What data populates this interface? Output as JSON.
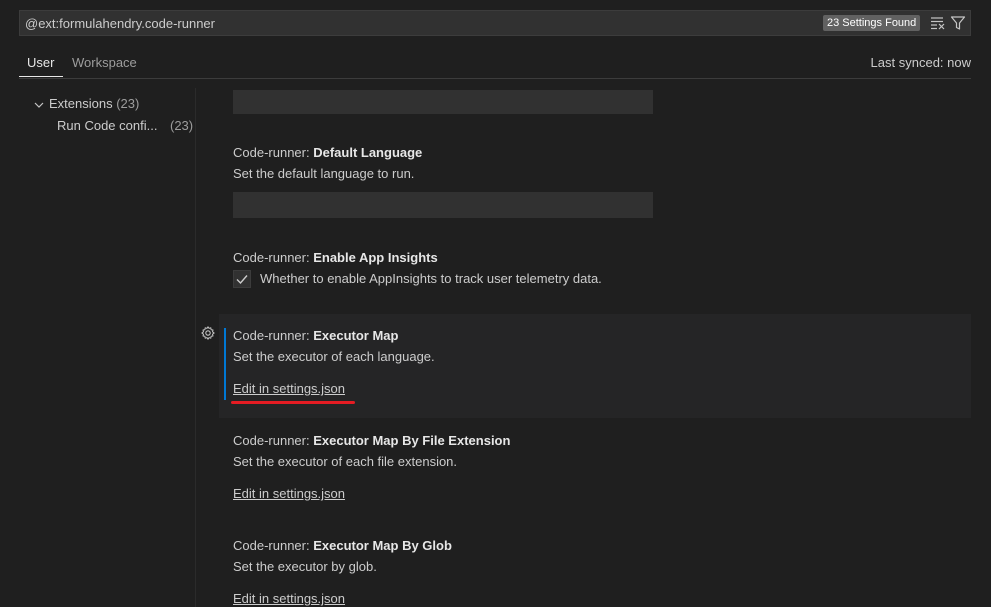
{
  "search": {
    "query": "@ext:formulahendry.code-runner",
    "results_badge": "23 Settings Found",
    "clear_icon": "clear-filter-icon",
    "filter_icon": "filter-icon"
  },
  "tabs": {
    "user_label": "User",
    "workspace_label": "Workspace",
    "active": "User"
  },
  "sync_status": "Last synced: now",
  "toc": {
    "root_label": "Extensions",
    "root_count": "(23)",
    "child_label": "Run Code confi...",
    "child_count": "(23)"
  },
  "settings": [
    {
      "category": "Code-runner: ",
      "key": "Default Language",
      "description": "Set the default language to run.",
      "input_value": ""
    },
    {
      "category": "Code-runner: ",
      "key": "Enable App Insights",
      "checkbox_label": "Whether to enable AppInsights to track user telemetry data.",
      "checked": true
    },
    {
      "category": "Code-runner: ",
      "key": "Executor Map",
      "description": "Set the executor of each language.",
      "link": "Edit in settings.json"
    },
    {
      "category": "Code-runner: ",
      "key": "Executor Map By File Extension",
      "description": "Set the executor of each file extension.",
      "link": "Edit in settings.json"
    },
    {
      "category": "Code-runner: ",
      "key": "Executor Map By Glob",
      "description": "Set the executor by glob.",
      "link": "Edit in settings.json"
    }
  ],
  "colors": {
    "background": "#1f1f1f",
    "focus_accent": "#0078d4",
    "annotation_red": "#e51c23"
  }
}
